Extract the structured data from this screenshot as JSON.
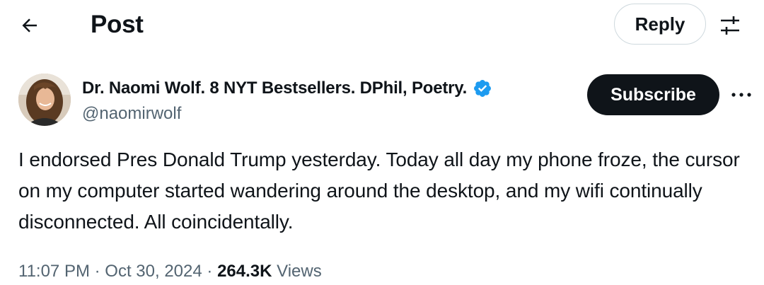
{
  "header": {
    "title": "Post",
    "reply_label": "Reply"
  },
  "author": {
    "display_name": "Dr. Naomi Wolf. 8 NYT Bestsellers. DPhil, Poetry.",
    "handle": "@naomirwolf",
    "verified": true,
    "subscribe_label": "Subscribe"
  },
  "post": {
    "text": "I endorsed Pres Donald Trump yesterday. Today all day my phone froze, the cursor on my computer started wandering around the desktop, and my wifi continually disconnected. All coincidentally."
  },
  "meta": {
    "time": "11:07 PM",
    "separator": "·",
    "date": "Oct 30, 2024",
    "views_count": "264.3K",
    "views_label": "Views"
  },
  "colors": {
    "verified_blue": "#1d9bf0",
    "primary_text": "#0f1419",
    "secondary_text": "#536471",
    "border": "#cfd9de"
  },
  "icons": {
    "back": "arrow-left-icon",
    "settings": "sliders-icon",
    "verified": "verified-badge-icon",
    "more": "more-horizontal-icon"
  }
}
